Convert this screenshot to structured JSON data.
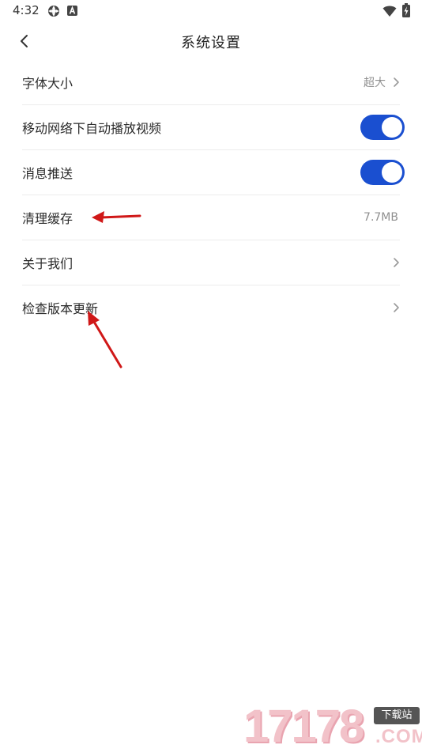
{
  "status_bar": {
    "time": "4:32",
    "icons": [
      "gear-icon",
      "a-letter-icon",
      "wifi-icon",
      "battery-charging-icon"
    ]
  },
  "header": {
    "title": "系统设置",
    "back_icon": "chevron-left-icon"
  },
  "settings": {
    "font_size": {
      "label": "字体大小",
      "value": "超大"
    },
    "autoplay": {
      "label": "移动网络下自动播放视频",
      "on": true
    },
    "push": {
      "label": "消息推送",
      "on": true
    },
    "cache": {
      "label": "清理缓存",
      "value": "7.7MB"
    },
    "about": {
      "label": "关于我们"
    },
    "update": {
      "label": "检查版本更新"
    }
  },
  "colors": {
    "toggle_on": "#1a4fd0",
    "annotation_arrow": "#d01818",
    "divider": "#ececec"
  },
  "watermark": {
    "digits": "17178",
    "tag": "下载站",
    "domain": ".COM"
  }
}
